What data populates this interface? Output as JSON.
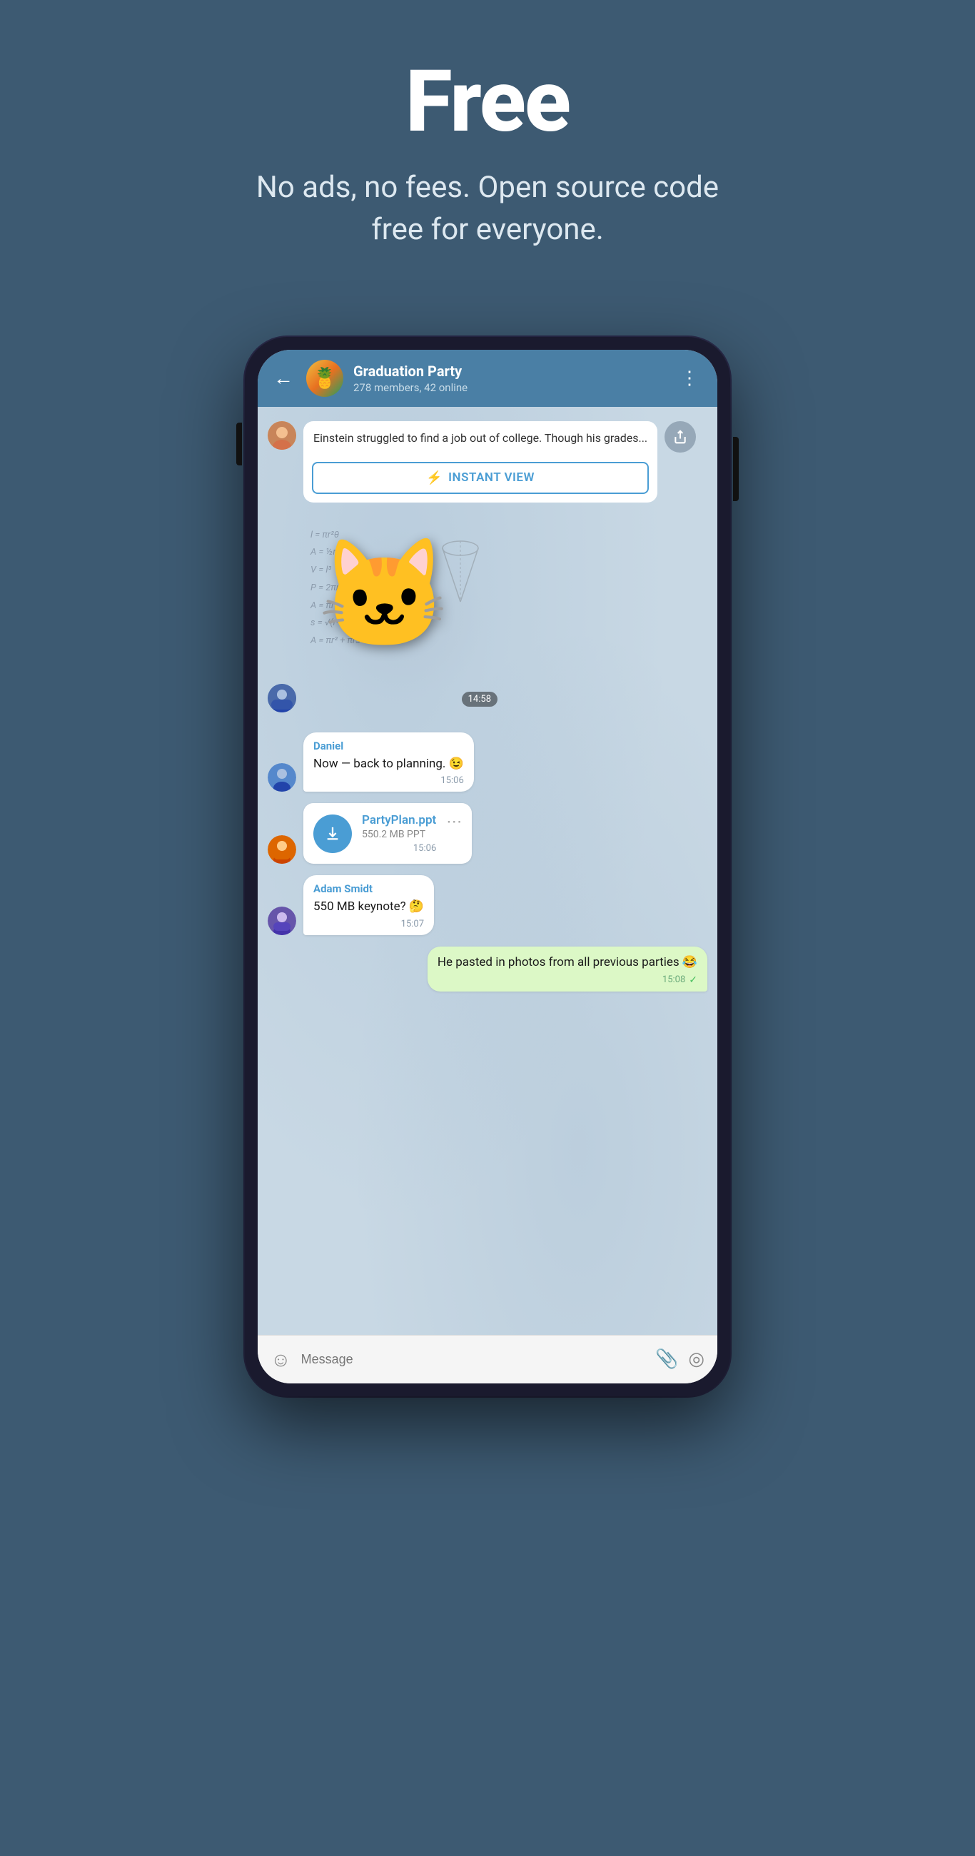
{
  "hero": {
    "title": "Free",
    "subtitle": "No ads, no fees. Open source code free for everyone."
  },
  "phone": {
    "header": {
      "back_label": "←",
      "group_name": "Graduation Party",
      "group_members": "278 members, 42 online",
      "more_label": "⋮"
    },
    "messages": [
      {
        "id": "article-msg",
        "type": "article",
        "body_text": "Einstein struggled to find a job out of college. Though his grades...",
        "instant_view_label": "INSTANT VIEW",
        "iv_icon": "⚡"
      },
      {
        "id": "sticker-msg",
        "type": "sticker",
        "time": "14:58",
        "math_text": "l = πr²θ\nA = ½r²θ\nV = l³\nP = 2πr\nA = πr²\ns = √(r² + h²)\nA = πr² + πrs"
      },
      {
        "id": "daniel-msg",
        "type": "text",
        "sender": "Daniel",
        "text": "Now — back to planning. 😉",
        "time": "15:06"
      },
      {
        "id": "file-msg",
        "type": "file",
        "file_name": "PartyPlan.ppt",
        "file_size": "550.2 MB PPT",
        "time": "15:06"
      },
      {
        "id": "adam-msg",
        "type": "text",
        "sender": "Adam Smidt",
        "text": "550 MB keynote? 🤔",
        "time": "15:07"
      },
      {
        "id": "own-msg",
        "type": "own",
        "text": "He pasted in photos from all previous parties 😂",
        "time": "15:08",
        "check": "✓"
      }
    ],
    "input": {
      "placeholder": "Message",
      "emoji_icon": "☺",
      "attach_icon": "📎",
      "camera_icon": "◎"
    }
  },
  "colors": {
    "bg": "#3d5a72",
    "chat_header": "#4a7fa5",
    "chat_body": "#c8d8e4",
    "bubble_own": "#dcf8c6",
    "accent_blue": "#4a9dd4"
  }
}
